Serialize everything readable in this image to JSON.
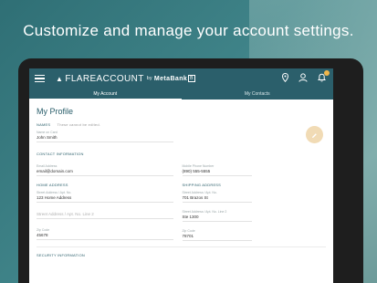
{
  "headline": "Customize and manage your account settings.",
  "app": {
    "brand": "FLAREACCOUNT",
    "brand_by": "by",
    "brand_bank": "MetaBank",
    "brand_bank_mark": "B"
  },
  "tabs": [
    {
      "label": "My Account",
      "active": true
    },
    {
      "label": "My Contacts",
      "active": false
    }
  ],
  "profile": {
    "title": "My Profile",
    "names": {
      "heading": "NAMES",
      "note": "These cannot be edited.",
      "name_label": "Name on Card",
      "name_value": "John Smith"
    },
    "contact": {
      "heading": "CONTACT INFORMATION",
      "email_label": "Email Address",
      "email_value": "email@domain.com",
      "phone_label": "Mobile Phone Number",
      "phone_value": "(890) 555-5555"
    },
    "home_address": {
      "heading": "HOME ADDRESS",
      "line1_label": "Street Address / Apt. No.",
      "line1_value": "123 Home Address",
      "line2_placeholder": "Street Address / Apt. No. Line 2",
      "zip_label": "Zip Code",
      "zip_value": "45678"
    },
    "shipping_address": {
      "heading": "SHIPPING ADDRESS",
      "line1_label": "Street Address / Apt. No.",
      "line1_value": "701 Brazos St",
      "line2_label": "Street Address / Apt. No. Line 2",
      "line2_value": "Ste 1300",
      "zip_label": "Zip Code",
      "zip_value": "78701"
    },
    "security": {
      "heading": "SECURITY INFORMATION"
    }
  },
  "icons": {
    "menu": "hamburger-menu-icon",
    "location": "location-pin-icon",
    "profile": "user-icon",
    "notifications": "bell-icon",
    "edit": "pencil-icon"
  },
  "colors": {
    "app_bar": "#2b5f6b",
    "accent_fab": "#f1dbb5",
    "badge": "#f0b64a"
  }
}
